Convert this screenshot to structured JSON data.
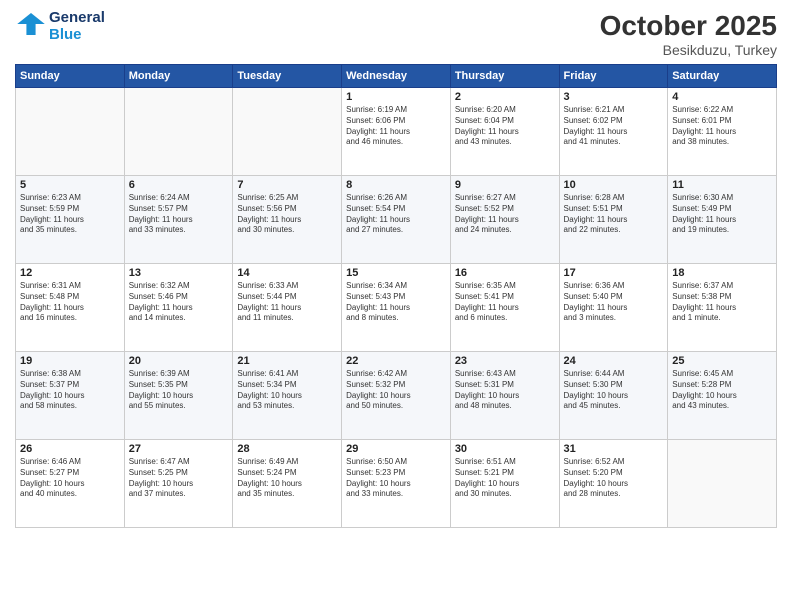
{
  "header": {
    "logo_line1": "General",
    "logo_line2": "Blue",
    "month_title": "October 2025",
    "subtitle": "Besikduzu, Turkey"
  },
  "weekdays": [
    "Sunday",
    "Monday",
    "Tuesday",
    "Wednesday",
    "Thursday",
    "Friday",
    "Saturday"
  ],
  "weeks": [
    [
      {
        "day": "",
        "text": ""
      },
      {
        "day": "",
        "text": ""
      },
      {
        "day": "",
        "text": ""
      },
      {
        "day": "1",
        "text": "Sunrise: 6:19 AM\nSunset: 6:06 PM\nDaylight: 11 hours\nand 46 minutes."
      },
      {
        "day": "2",
        "text": "Sunrise: 6:20 AM\nSunset: 6:04 PM\nDaylight: 11 hours\nand 43 minutes."
      },
      {
        "day": "3",
        "text": "Sunrise: 6:21 AM\nSunset: 6:02 PM\nDaylight: 11 hours\nand 41 minutes."
      },
      {
        "day": "4",
        "text": "Sunrise: 6:22 AM\nSunset: 6:01 PM\nDaylight: 11 hours\nand 38 minutes."
      }
    ],
    [
      {
        "day": "5",
        "text": "Sunrise: 6:23 AM\nSunset: 5:59 PM\nDaylight: 11 hours\nand 35 minutes."
      },
      {
        "day": "6",
        "text": "Sunrise: 6:24 AM\nSunset: 5:57 PM\nDaylight: 11 hours\nand 33 minutes."
      },
      {
        "day": "7",
        "text": "Sunrise: 6:25 AM\nSunset: 5:56 PM\nDaylight: 11 hours\nand 30 minutes."
      },
      {
        "day": "8",
        "text": "Sunrise: 6:26 AM\nSunset: 5:54 PM\nDaylight: 11 hours\nand 27 minutes."
      },
      {
        "day": "9",
        "text": "Sunrise: 6:27 AM\nSunset: 5:52 PM\nDaylight: 11 hours\nand 24 minutes."
      },
      {
        "day": "10",
        "text": "Sunrise: 6:28 AM\nSunset: 5:51 PM\nDaylight: 11 hours\nand 22 minutes."
      },
      {
        "day": "11",
        "text": "Sunrise: 6:30 AM\nSunset: 5:49 PM\nDaylight: 11 hours\nand 19 minutes."
      }
    ],
    [
      {
        "day": "12",
        "text": "Sunrise: 6:31 AM\nSunset: 5:48 PM\nDaylight: 11 hours\nand 16 minutes."
      },
      {
        "day": "13",
        "text": "Sunrise: 6:32 AM\nSunset: 5:46 PM\nDaylight: 11 hours\nand 14 minutes."
      },
      {
        "day": "14",
        "text": "Sunrise: 6:33 AM\nSunset: 5:44 PM\nDaylight: 11 hours\nand 11 minutes."
      },
      {
        "day": "15",
        "text": "Sunrise: 6:34 AM\nSunset: 5:43 PM\nDaylight: 11 hours\nand 8 minutes."
      },
      {
        "day": "16",
        "text": "Sunrise: 6:35 AM\nSunset: 5:41 PM\nDaylight: 11 hours\nand 6 minutes."
      },
      {
        "day": "17",
        "text": "Sunrise: 6:36 AM\nSunset: 5:40 PM\nDaylight: 11 hours\nand 3 minutes."
      },
      {
        "day": "18",
        "text": "Sunrise: 6:37 AM\nSunset: 5:38 PM\nDaylight: 11 hours\nand 1 minute."
      }
    ],
    [
      {
        "day": "19",
        "text": "Sunrise: 6:38 AM\nSunset: 5:37 PM\nDaylight: 10 hours\nand 58 minutes."
      },
      {
        "day": "20",
        "text": "Sunrise: 6:39 AM\nSunset: 5:35 PM\nDaylight: 10 hours\nand 55 minutes."
      },
      {
        "day": "21",
        "text": "Sunrise: 6:41 AM\nSunset: 5:34 PM\nDaylight: 10 hours\nand 53 minutes."
      },
      {
        "day": "22",
        "text": "Sunrise: 6:42 AM\nSunset: 5:32 PM\nDaylight: 10 hours\nand 50 minutes."
      },
      {
        "day": "23",
        "text": "Sunrise: 6:43 AM\nSunset: 5:31 PM\nDaylight: 10 hours\nand 48 minutes."
      },
      {
        "day": "24",
        "text": "Sunrise: 6:44 AM\nSunset: 5:30 PM\nDaylight: 10 hours\nand 45 minutes."
      },
      {
        "day": "25",
        "text": "Sunrise: 6:45 AM\nSunset: 5:28 PM\nDaylight: 10 hours\nand 43 minutes."
      }
    ],
    [
      {
        "day": "26",
        "text": "Sunrise: 6:46 AM\nSunset: 5:27 PM\nDaylight: 10 hours\nand 40 minutes."
      },
      {
        "day": "27",
        "text": "Sunrise: 6:47 AM\nSunset: 5:25 PM\nDaylight: 10 hours\nand 37 minutes."
      },
      {
        "day": "28",
        "text": "Sunrise: 6:49 AM\nSunset: 5:24 PM\nDaylight: 10 hours\nand 35 minutes."
      },
      {
        "day": "29",
        "text": "Sunrise: 6:50 AM\nSunset: 5:23 PM\nDaylight: 10 hours\nand 33 minutes."
      },
      {
        "day": "30",
        "text": "Sunrise: 6:51 AM\nSunset: 5:21 PM\nDaylight: 10 hours\nand 30 minutes."
      },
      {
        "day": "31",
        "text": "Sunrise: 6:52 AM\nSunset: 5:20 PM\nDaylight: 10 hours\nand 28 minutes."
      },
      {
        "day": "",
        "text": ""
      }
    ]
  ]
}
